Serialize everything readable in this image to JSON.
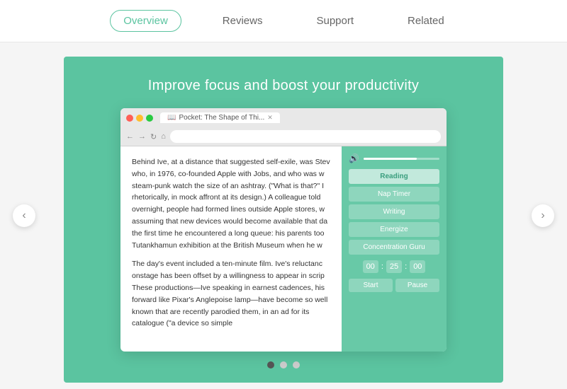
{
  "nav": {
    "items": [
      {
        "id": "overview",
        "label": "Overview",
        "active": true
      },
      {
        "id": "reviews",
        "label": "Reviews",
        "active": false
      },
      {
        "id": "support",
        "label": "Support",
        "active": false
      },
      {
        "id": "related",
        "label": "Related",
        "active": false
      }
    ]
  },
  "card": {
    "title": "Improve focus and boost your productivity",
    "browser": {
      "tab_label": "Pocket: The Shape of Thi...",
      "url": "",
      "article_p1": "Behind Ive, at a distance that suggested self-exile, was Stev who, in 1976, co-founded Apple with Jobs, and who was w steam-punk watch the size of an ashtray. (\"What is that?\" I rhetorically, in mock affront at its design.) A colleague told overnight, people had formed lines outside Apple stores, w assuming that new devices would become available that da the first time he encountered a long queue: his parents too Tutankhamun exhibition at the British Museum when he w",
      "article_p2": "The day's event included a ten-minute film. Ive's reluctanc onstage has been offset by a willingness to appear in scrip These productions—Ive speaking in earnest cadences, his forward like Pixar's Anglepoise lamp—have become so well known that are recently parodied them, in an ad for its catalogue (\"a device so simple"
    },
    "panel": {
      "volume_level": 70,
      "buttons": [
        {
          "label": "Reading",
          "active": true
        },
        {
          "label": "Nap Timer",
          "active": false
        },
        {
          "label": "Writing",
          "active": false
        },
        {
          "label": "Energize",
          "active": false
        },
        {
          "label": "Concentration Guru",
          "active": false
        }
      ],
      "timer": {
        "hours": "00",
        "minutes": "25",
        "seconds": "00"
      },
      "timer_start": "Start",
      "timer_pause": "Pause"
    }
  },
  "indicators": {
    "dots": [
      {
        "active": true
      },
      {
        "active": false
      },
      {
        "active": false
      }
    ]
  },
  "arrows": {
    "left": "‹",
    "right": "›"
  }
}
